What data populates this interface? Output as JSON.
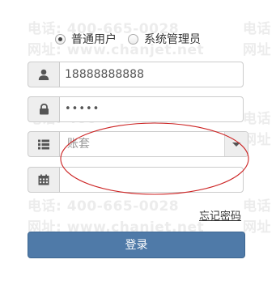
{
  "watermark": {
    "phone": "电话: 400-665-0028",
    "site": "网址: www.chanjet.net",
    "phone_partial": "电话",
    "site_partial": "网址"
  },
  "login_type": {
    "options": [
      {
        "label": "普通用户",
        "checked": true
      },
      {
        "label": "系统管理员",
        "checked": false
      }
    ]
  },
  "form": {
    "username": {
      "value": "18888888888",
      "icon": "user-icon"
    },
    "password": {
      "value": "•••••",
      "icon": "lock-icon"
    },
    "account_set": {
      "placeholder": "账套",
      "icon": "list-icon"
    },
    "date": {
      "value": "",
      "icon": "calendar-icon"
    }
  },
  "forgot_password": "忘记密码",
  "login_button": "登录",
  "colors": {
    "primary_button": "#4f7aa8",
    "annotation_ellipse": "#cc2222",
    "watermark": "#ececec"
  }
}
